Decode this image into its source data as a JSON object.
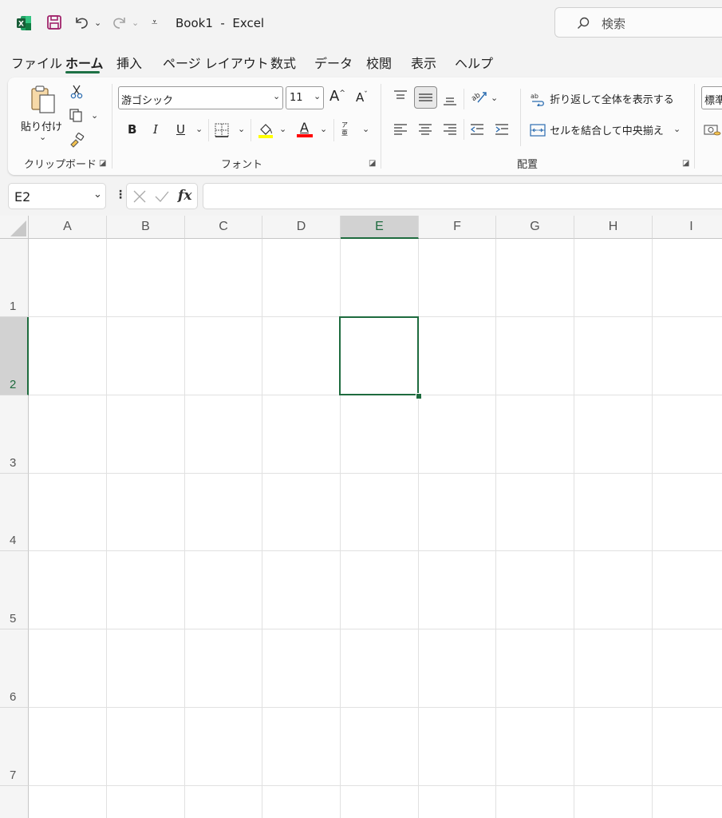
{
  "titlebar": {
    "doc_title": "Book1  -  Excel",
    "search_placeholder": "検索"
  },
  "menu": {
    "tabs": [
      "ファイル",
      "ホーム",
      "挿入",
      "ページ レイアウト",
      "数式",
      "データ",
      "校閲",
      "表示",
      "ヘルプ"
    ],
    "active_tab": "ホーム"
  },
  "ribbon": {
    "clipboard": {
      "paste_label": "貼り付け",
      "group_label": "クリップボード"
    },
    "font": {
      "font_name": "游ゴシック",
      "font_size": "11",
      "grow": "A",
      "shrink": "A",
      "bold": "B",
      "italic": "I",
      "underline": "U",
      "font_color": "A",
      "phonetic": "ア亜",
      "group_label": "フォント"
    },
    "alignment": {
      "wrap_text": "折り返して全体を表示する",
      "merge_center": "セルを結合して中央揃え",
      "group_label": "配置"
    },
    "number": {
      "format_partial": "標準"
    },
    "colors": {
      "accent": "#1e7145",
      "highlight": "#ffff00",
      "font_red": "#ff0000"
    }
  },
  "formula_bar": {
    "name_box": "E2",
    "fx": "fx",
    "formula": ""
  },
  "grid": {
    "columns": [
      "A",
      "B",
      "C",
      "D",
      "E",
      "F",
      "G",
      "H",
      "I"
    ],
    "rows": [
      "1",
      "2",
      "3",
      "4",
      "5",
      "6",
      "7"
    ],
    "selected_cell": "E2"
  }
}
